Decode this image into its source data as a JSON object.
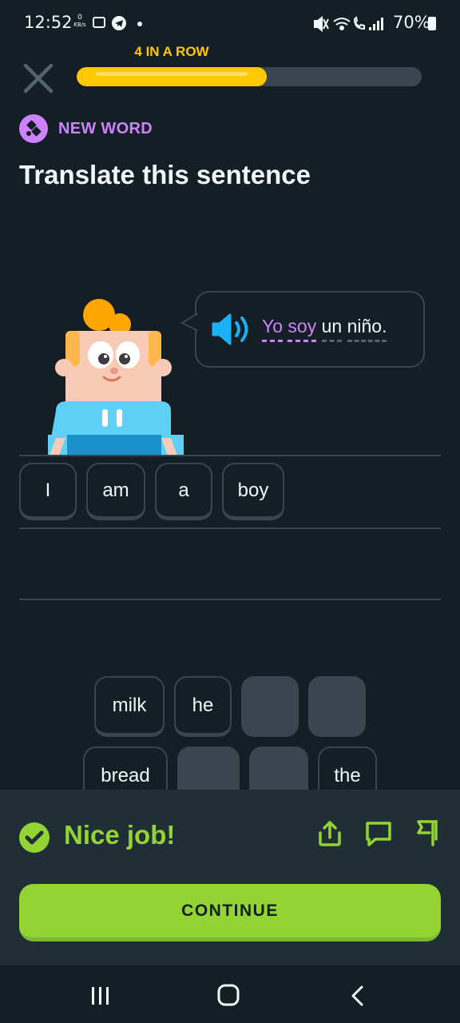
{
  "status_bar": {
    "time": "12:52",
    "net_speed": "0",
    "net_unit": "KB/s",
    "battery": "70%"
  },
  "header": {
    "streak_label": "4 IN A ROW",
    "progress": 0.55
  },
  "badge": {
    "label": "NEW WORD"
  },
  "title": "Translate this sentence",
  "prompt": {
    "words": [
      "Yo",
      "soy",
      "un",
      "niño."
    ],
    "new_words": [
      true,
      true,
      false,
      false
    ]
  },
  "answer": {
    "chips": [
      "I",
      "am",
      "a",
      "boy"
    ]
  },
  "word_bank": {
    "row1": [
      "milk",
      "he",
      "",
      ""
    ],
    "row2": [
      "bread",
      "",
      "",
      "the"
    ]
  },
  "feedback": {
    "message": "Nice job!",
    "continue_label": "CONTINUE"
  },
  "colors": {
    "background": "#131f24",
    "accent_yellow": "#ffc800",
    "accent_purple": "#ce82ff",
    "success_green": "#93d333",
    "panel": "#202f36"
  }
}
